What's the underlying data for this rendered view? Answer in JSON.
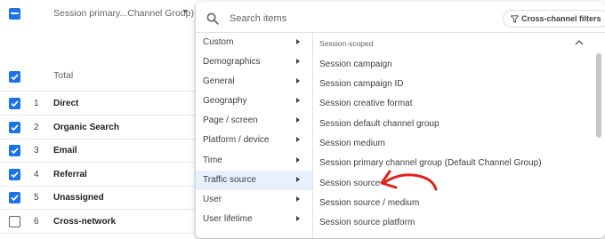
{
  "table": {
    "dimension_select": "Session primary...Channel Group)",
    "total_label": "Total",
    "rows": [
      {
        "num": "1",
        "name": "Direct",
        "checked": true
      },
      {
        "num": "2",
        "name": "Organic Search",
        "checked": true
      },
      {
        "num": "3",
        "name": "Email",
        "checked": true
      },
      {
        "num": "4",
        "name": "Referral",
        "checked": true
      },
      {
        "num": "5",
        "name": "Unassigned",
        "checked": true
      },
      {
        "num": "6",
        "name": "Cross-network",
        "checked": false
      }
    ]
  },
  "dropdown": {
    "search_placeholder": "Search items",
    "filter_button": "Cross-channel filters",
    "categories": [
      {
        "label": "Custom"
      },
      {
        "label": "Demographics"
      },
      {
        "label": "General"
      },
      {
        "label": "Geography"
      },
      {
        "label": "Page / screen"
      },
      {
        "label": "Platform / device"
      },
      {
        "label": "Time"
      },
      {
        "label": "Traffic source",
        "selected": true
      },
      {
        "label": "User"
      },
      {
        "label": "User lifetime"
      }
    ],
    "section_header": "Session-scoped",
    "items": [
      "Session campaign",
      "Session campaign ID",
      "Session creative format",
      "Session default channel group",
      "Session medium",
      "Session primary channel group (Default Channel Group)",
      "Session source",
      "Session source / medium",
      "Session source platform"
    ]
  },
  "colors": {
    "accent": "#1a73e8",
    "selected_bg": "#e8f0fe",
    "annotation_arrow": "#e0201b"
  }
}
